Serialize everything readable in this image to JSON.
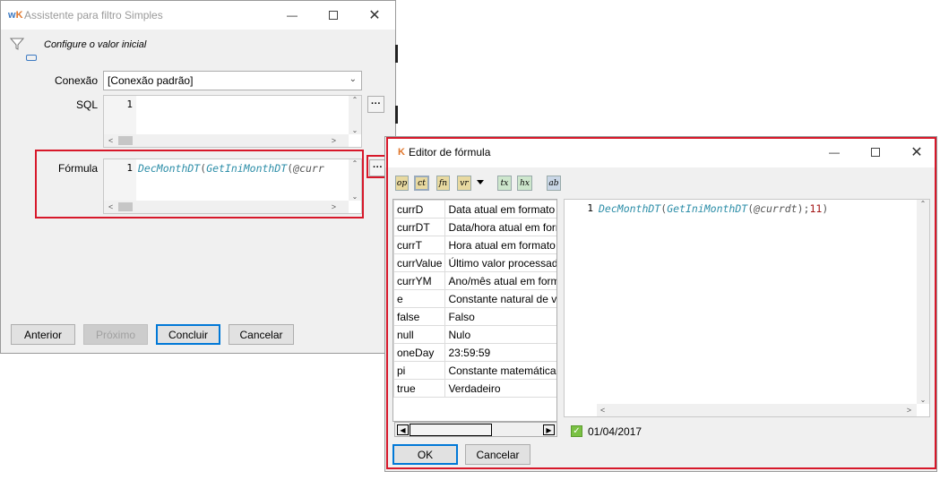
{
  "dialog": {
    "logo": "wK",
    "title": "Assistente para filtro Simples",
    "subtitle": "Configure o valor inicial",
    "conexao_label": "Conexão",
    "conexao_value": "[Conexão padrão]",
    "sql_label": "SQL",
    "sql_line": "1",
    "formula_label": "Fórmula",
    "formula_line": "1",
    "formula_fn1": "DecMonthDT",
    "formula_p1": "(",
    "formula_fn2": "GetIniMonthDT",
    "formula_p2": "(",
    "formula_var": "@curr",
    "ellipsis": "···",
    "buttons": {
      "anterior": "Anterior",
      "proximo": "Próximo",
      "concluir": "Concluir",
      "cancelar": "Cancelar"
    }
  },
  "editor": {
    "logo": "K",
    "title": "Editor de fórmula",
    "toolbar": [
      {
        "label": "op",
        "color": "#e8d9a0"
      },
      {
        "label": "ct",
        "color": "#c9d6e6"
      },
      {
        "label": "fn",
        "color": "#e8d9a0"
      },
      {
        "label": "vr",
        "color": "#e8d9a0"
      },
      {
        "label": "tx",
        "color": "#cde6cc"
      },
      {
        "label": "hx",
        "color": "#cde6cc"
      },
      {
        "label": "ab",
        "color": "#c9d6e6"
      }
    ],
    "constants": [
      {
        "name": "currD",
        "desc": "Data atual em formato i"
      },
      {
        "name": "currDT",
        "desc": "Data/hora atual em form"
      },
      {
        "name": "currT",
        "desc": "Hora atual em formato"
      },
      {
        "name": "currValue",
        "desc": "Último valor processado"
      },
      {
        "name": "currYM",
        "desc": "Ano/mês atual em form"
      },
      {
        "name": "e",
        "desc": "Constante natural de va"
      },
      {
        "name": "false",
        "desc": "Falso"
      },
      {
        "name": "null",
        "desc": "Nulo"
      },
      {
        "name": "oneDay",
        "desc": "23:59:59"
      },
      {
        "name": "pi",
        "desc": "Constante matemática d"
      },
      {
        "name": "true",
        "desc": "Verdadeiro"
      }
    ],
    "code_line": "1",
    "code_fn1": "DecMonthDT",
    "code_p1": "(",
    "code_fn2": "GetIniMonthDT",
    "code_p2": "(",
    "code_var": "@currdt",
    "code_p3": ");",
    "code_num": "11",
    "code_p4": ")",
    "result": "01/04/2017",
    "ok": "OK",
    "cancelar": "Cancelar"
  }
}
